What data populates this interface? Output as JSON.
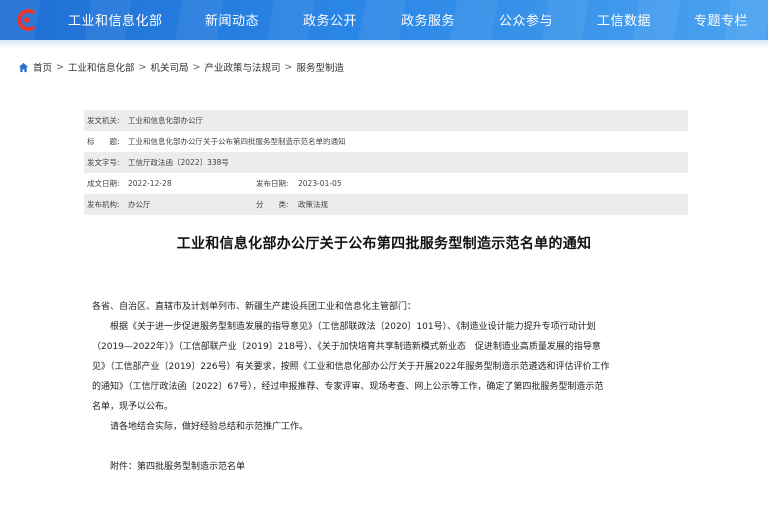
{
  "header": {
    "logo_icon": "miit-logo-icon",
    "brand_color": "#2a7fe0",
    "nav": [
      "工业和信息化部",
      "新闻动态",
      "政务公开",
      "政务服务",
      "公众参与",
      "工信数据",
      "专题专栏"
    ]
  },
  "breadcrumb": {
    "home_icon": "home-icon",
    "items": [
      "首页",
      "工业和信息化部",
      "机关司局",
      "产业政策与法规司",
      "服务型制造"
    ],
    "separator": ">"
  },
  "meta": {
    "issuer_label": "发文机关:",
    "issuer": "工业和信息化部办公厅",
    "title_label": "标　　题:",
    "title": "工业和信息化部办公厅关于公布第四批服务型制造示范名单的通知",
    "docno_label": "发文字号:",
    "docno": "工信厅政法函〔2022〕338号",
    "created_label": "成文日期:",
    "created": "2022-12-28",
    "published_label": "发布日期:",
    "published": "2023-01-05",
    "org_label": "发布机构:",
    "org": "办公厅",
    "category_label": "分　　类:",
    "category": "政策法规"
  },
  "document": {
    "title": "工业和信息化部办公厅关于公布第四批服务型制造示范名单的通知",
    "lines": [
      "各省、自治区、直辖市及计划单列市、新疆生产建设兵团工业和信息化主管部门：",
      "　　根据《关于进一步促进服务型制造发展的指导意见》（工信部联政法〔2020〕101号）、《制造业设计能力提升专项行动计划",
      "（2019—2022年）》（工信部联产业〔2019〕218号）、《关于加快培育共享制造新模式新业态　促进制造业高质量发展的指导意",
      "见》（工信部产业〔2019〕226号）有关要求，按照《工业和信息化部办公厅关于开展2022年服务型制造示范遴选和评估评价工作",
      "的通知》（工信厅政法函〔2022〕67号），经过申报推荐、专家评审、现场考查、网上公示等工作，确定了第四批服务型制造示范",
      "名单，现予以公布。",
      "　　请各地结合实际，做好经验总结和示范推广工作。",
      "",
      "　　附件：第四批服务型制造示范名单"
    ]
  }
}
